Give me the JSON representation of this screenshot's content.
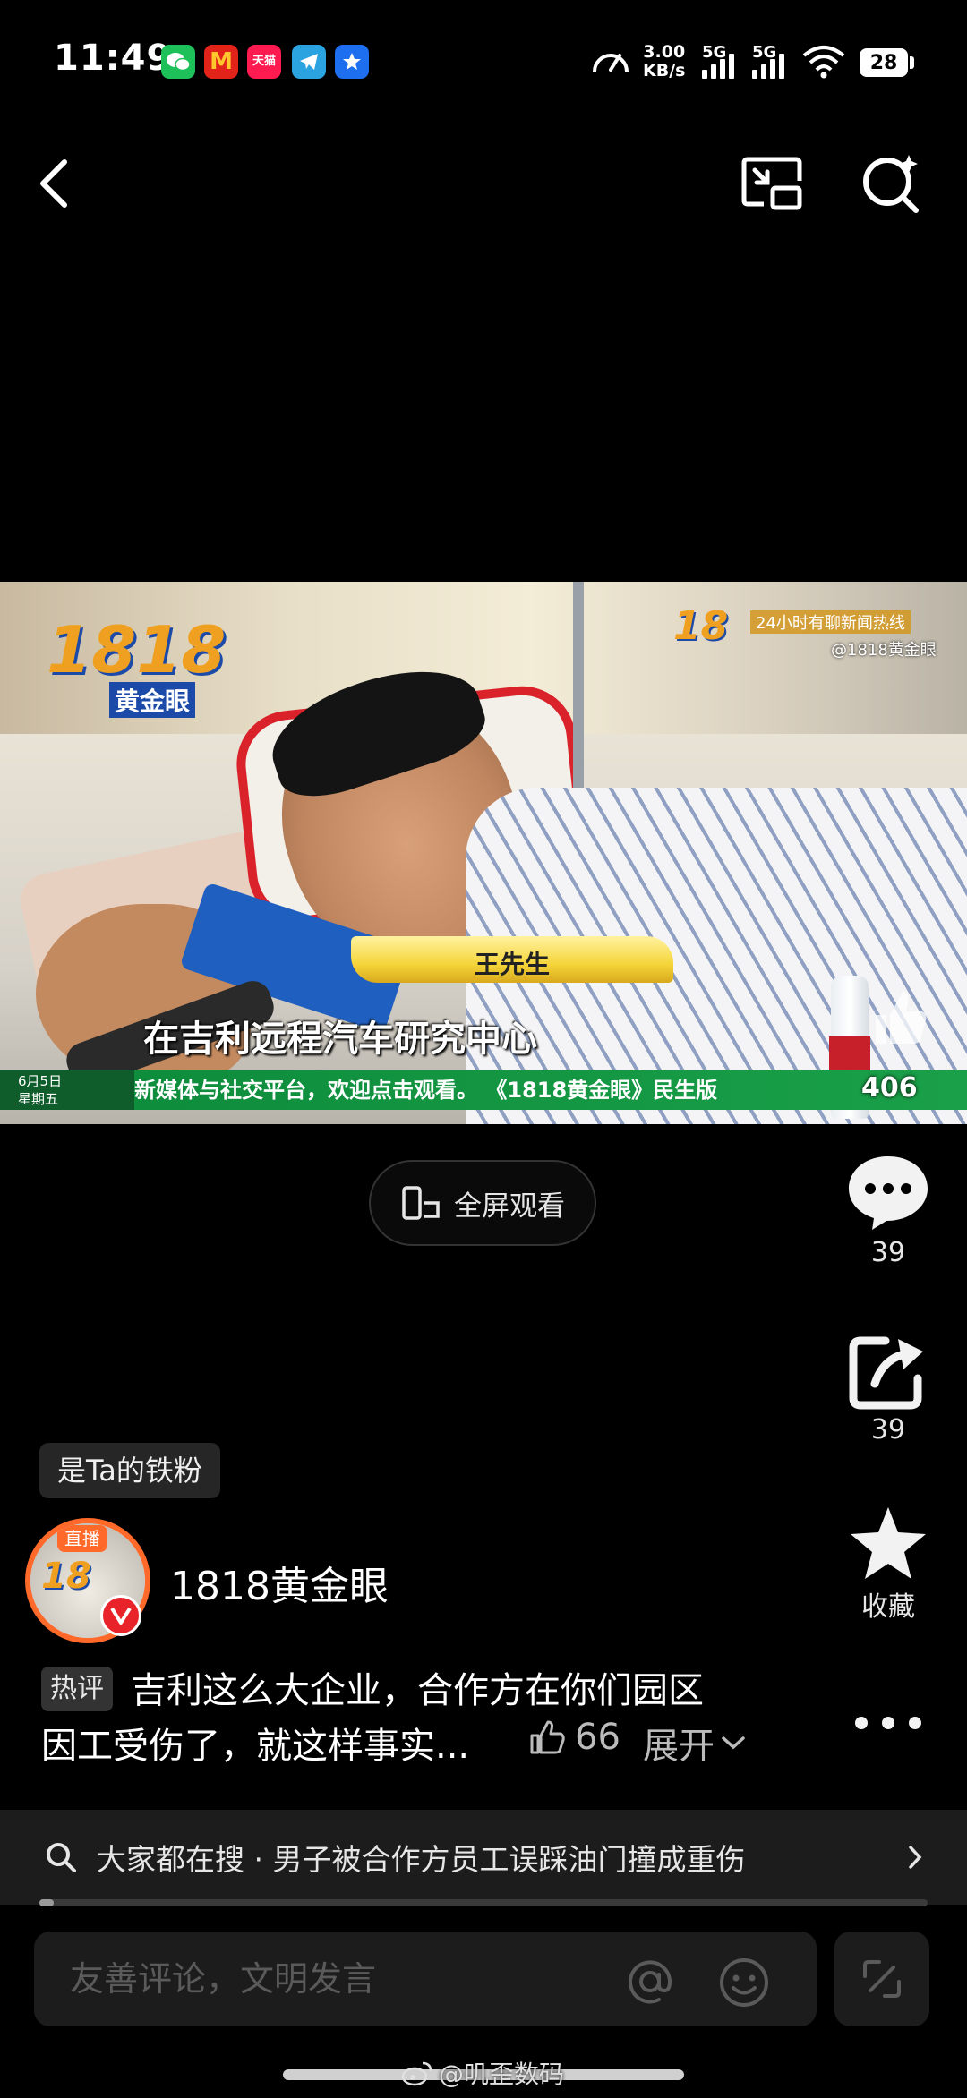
{
  "status_bar": {
    "time": "11:49",
    "net_speed_value": "3.00",
    "net_speed_unit": "KB/s",
    "signal1_label": "5G",
    "signal2_label": "5G",
    "battery": "28",
    "app_icons": [
      "wechat-icon",
      "mcdonalds-icon",
      "tmall-icon",
      "telegram-icon",
      "app-store-icon"
    ]
  },
  "top_nav": {
    "icons": [
      "back-icon",
      "picture-in-picture-icon",
      "search-icon"
    ]
  },
  "video": {
    "channel_logo_text": "黄金眼",
    "watermark_line1": "24小时有聊新闻热线",
    "watermark_line2": "@1818黄金眼",
    "speaker_name": "王先生",
    "subtitle": "在吉利远程汽车研究中心",
    "ticker_date": "6月5日",
    "ticker_weekday": "星期五",
    "ticker_text": "新媒体与社交平台，欢迎点击观看。    《1818黄金眼》民生版     ",
    "ticker_counter": "406"
  },
  "fullscreen_button": {
    "label": "全屏观看"
  },
  "side_actions": {
    "comments": {
      "icon": "comment-icon",
      "count": "39"
    },
    "share": {
      "icon": "share-icon",
      "count": "39"
    },
    "favorite": {
      "icon": "star-icon",
      "label": "收藏"
    },
    "more": {
      "icon": "more-icon"
    }
  },
  "fan_badge": "是Ta的铁粉",
  "account": {
    "live_badge": "直播",
    "name": "1818黄金眼"
  },
  "hot_comment": {
    "tag": "热评",
    "line1": "吉利这么大企业，合作方在你们园区",
    "line2": "因工受伤了，就这样事实...",
    "likes": "66",
    "expand_label": "展开"
  },
  "search_suggestion": {
    "text": "大家都在搜 · 男子被合作方员工误踩油门撞成重伤",
    "progress": 0.01
  },
  "comment_input": {
    "placeholder": "友善评论，文明发言"
  },
  "watermark": "@叽歪数码",
  "colors": {
    "avatar_ring": "#ff6a2a",
    "verified_badge": "#e8242a",
    "ticker_green": "#1aa049",
    "name_plate": "#f5d53a"
  }
}
